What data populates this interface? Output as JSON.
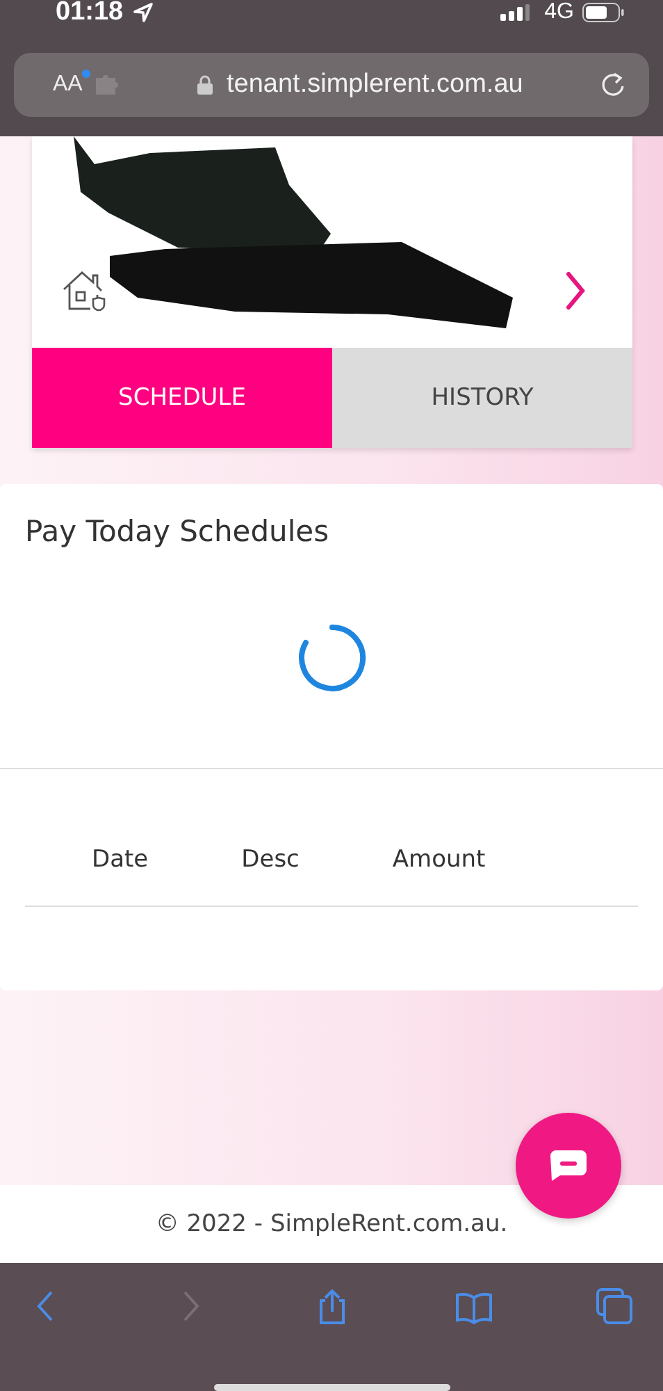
{
  "status_bar": {
    "time": "01:18",
    "network": "4G"
  },
  "address_bar": {
    "text_size_label": "AA",
    "url": "tenant.simplerent.com.au"
  },
  "property_card": {
    "tabs": [
      {
        "label": "SCHEDULE",
        "selected": true
      },
      {
        "label": "HISTORY",
        "selected": false
      }
    ]
  },
  "schedules": {
    "title": "Pay Today Schedules",
    "loading": true,
    "columns": [
      "Date",
      "Desc",
      "Amount"
    ]
  },
  "footer": {
    "text": "© 2022 - SimpleRent.com.au."
  },
  "toolbar": [
    {
      "kind": "back",
      "disabled": false
    },
    {
      "kind": "forward",
      "disabled": true
    },
    {
      "kind": "share",
      "disabled": false
    },
    {
      "kind": "bookmarks",
      "disabled": false
    },
    {
      "kind": "tabs",
      "disabled": false
    }
  ]
}
